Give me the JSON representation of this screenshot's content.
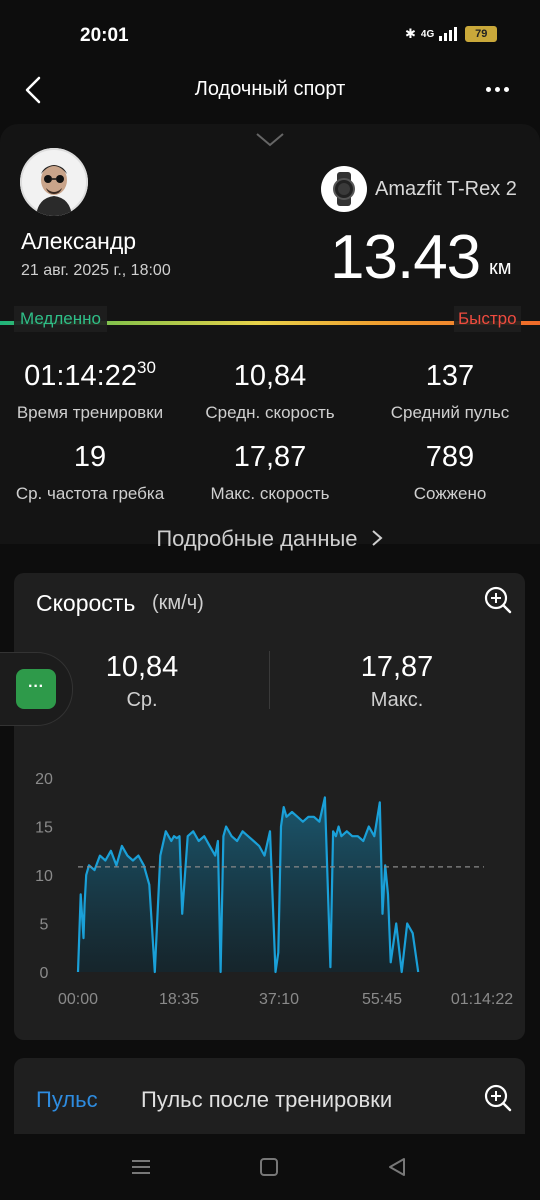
{
  "status": {
    "time": "20:01",
    "network": "4G",
    "battery": "79"
  },
  "header": {
    "title": "Лодочный спорт"
  },
  "user": {
    "name": "Александр",
    "date": "21 авг. 2025 г., 18:00"
  },
  "device": {
    "name": "Amazfit T-Rex 2"
  },
  "distance": {
    "value": "13.43",
    "unit": "км"
  },
  "pace_bar": {
    "slow_label": "Медленно",
    "fast_label": "Быстро"
  },
  "stats": [
    {
      "value": "01:14:22",
      "sup": "30",
      "label": "Время тренировки"
    },
    {
      "value": "10,84",
      "sup": "",
      "label": "Средн. скорость"
    },
    {
      "value": "137",
      "sup": "",
      "label": "Средний пульс"
    },
    {
      "value": "19",
      "sup": "",
      "label": "Ср. частота гребка"
    },
    {
      "value": "17,87",
      "sup": "",
      "label": "Макс. скорость"
    },
    {
      "value": "789",
      "sup": "",
      "label": "Сожжено"
    }
  ],
  "details_link": "Подробные данные",
  "speed_card": {
    "title": "Скорость",
    "unit": "(км/ч)",
    "avg_value": "10,84",
    "avg_label": "Ср.",
    "max_value": "17,87",
    "max_label": "Макс."
  },
  "pulse_card": {
    "tab_active": "Пульс",
    "tab_other": "Пульс после тренировки"
  },
  "float_button": {
    "icon": "chat-dots-icon",
    "text": "···"
  },
  "colors": {
    "accent": "#2e8ce0",
    "line": "#1aa0d8",
    "slow": "#2fbf88",
    "fast": "#ef4b3f"
  },
  "chart_data": {
    "type": "area",
    "title": "Скорость",
    "ylabel": "(км/ч)",
    "xlabel": "",
    "ylim": [
      0,
      20
    ],
    "yticks": [
      "0",
      "5",
      "10",
      "15",
      "20"
    ],
    "xticks": [
      "00:00",
      "18:35",
      "37:10",
      "55:45",
      "01:14:22"
    ],
    "average": 10.84,
    "x": [
      0,
      0.5,
      1,
      1.2,
      1.5,
      2,
      3,
      4,
      5,
      6,
      7,
      8,
      9,
      10,
      11,
      12,
      13,
      14,
      15,
      16,
      17,
      17.5,
      18,
      18.5,
      19,
      20,
      21,
      22,
      23,
      24,
      25,
      25.5,
      26,
      26.5,
      27,
      28,
      29,
      30,
      31,
      32,
      33,
      34,
      35,
      36,
      36.5,
      37,
      37.5,
      38,
      39,
      40,
      41,
      42,
      43,
      44,
      45,
      46,
      46.5,
      47,
      47.5,
      48,
      49,
      50,
      51,
      52,
      53,
      54,
      55,
      55.5,
      56,
      56.5,
      57,
      58,
      59,
      60,
      61,
      62,
      63,
      64,
      65,
      65.5,
      66,
      67,
      68,
      69,
      69.5,
      70,
      70.5,
      71,
      71.5,
      72,
      72.5,
      73,
      73.5,
      74
    ],
    "y": [
      0,
      8,
      3.5,
      7,
      10,
      11,
      10.5,
      12,
      11.5,
      12.5,
      11,
      13,
      12,
      11.5,
      12,
      11,
      9,
      0,
      12,
      14.5,
      13.5,
      14,
      13.8,
      14,
      6,
      14,
      14.5,
      13.5,
      14,
      13,
      12,
      13.5,
      0,
      14,
      15,
      14,
      13.5,
      14.5,
      14,
      13.5,
      13,
      12,
      14.5,
      0,
      2,
      15,
      17,
      16,
      16.5,
      16,
      15.5,
      16,
      16,
      15.5,
      18,
      0.5,
      14.5,
      14,
      15,
      14,
      14.5,
      14,
      14,
      13.5,
      15,
      14,
      17.5,
      6,
      11,
      8,
      1,
      5,
      0,
      5,
      4,
      0
    ]
  }
}
